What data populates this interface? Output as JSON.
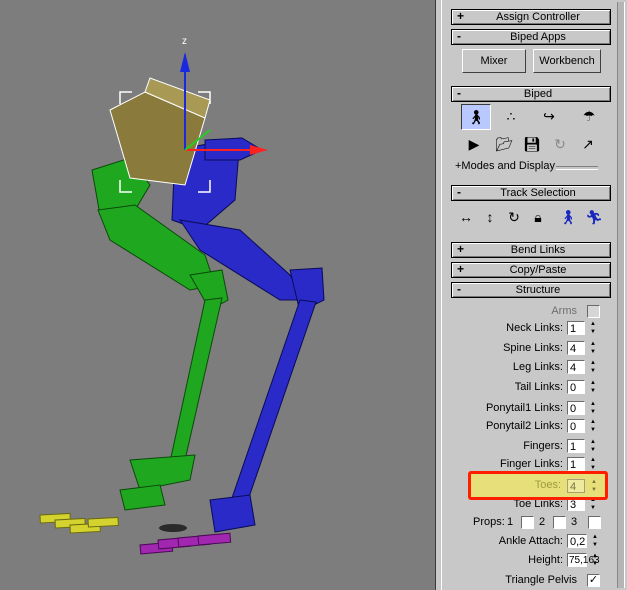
{
  "viewport": {
    "axis_z": "z",
    "colors": {
      "bg": "#7d7d7d",
      "right_leg": "#2a2ac8",
      "left_leg": "#1fa81f",
      "pelvis": "#8a7a3c",
      "toes_left": "#d3d22e",
      "toes_right": "#a126b0"
    }
  },
  "panel": {
    "assign_controller": {
      "sign": "+",
      "title": "Assign Controller"
    },
    "biped_apps": {
      "sign": "-",
      "title": "Biped Apps",
      "mixer": "Mixer",
      "workbench": "Workbench"
    },
    "biped": {
      "sign": "-",
      "title": "Biped",
      "modes_label": "+Modes and Display"
    },
    "track_selection": {
      "sign": "-",
      "title": "Track Selection"
    },
    "bend_links": {
      "sign": "+",
      "title": "Bend Links"
    },
    "copy_paste": {
      "sign": "+",
      "title": "Copy/Paste"
    },
    "structure": {
      "sign": "-",
      "title": "Structure",
      "arms": "Arms",
      "neck_links": {
        "label": "Neck Links:",
        "value": "1"
      },
      "spine_links": {
        "label": "Spine Links:",
        "value": "4"
      },
      "leg_links": {
        "label": "Leg Links:",
        "value": "4"
      },
      "tail_links": {
        "label": "Tail Links:",
        "value": "0"
      },
      "ponytail1_links": {
        "label": "Ponytail1 Links:",
        "value": "0"
      },
      "ponytail2_links": {
        "label": "Ponytail2 Links:",
        "value": "0"
      },
      "fingers": {
        "label": "Fingers:",
        "value": "1"
      },
      "finger_links": {
        "label": "Finger Links:",
        "value": "1"
      },
      "toes": {
        "label": "Toes:",
        "value": "4"
      },
      "toe_links": {
        "label": "Toe Links:",
        "value": "3"
      },
      "props": {
        "label": "Props:",
        "p1": "1",
        "p2": "2",
        "p3": "3"
      },
      "ankle_attach": {
        "label": "Ankle Attach:",
        "value": "0,2"
      },
      "height": {
        "label": "Height:",
        "value": "75,163"
      },
      "triangle_pelvis": {
        "label": "Triangle Pelvis",
        "checked": "✓"
      }
    }
  }
}
